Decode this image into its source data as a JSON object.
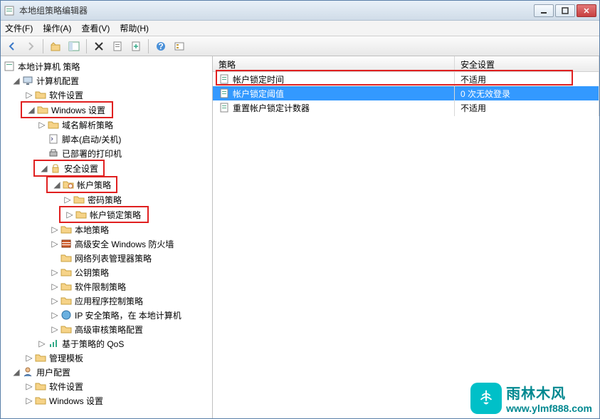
{
  "window": {
    "title": "本地组策略编辑器"
  },
  "menu": {
    "file": "文件(F)",
    "action": "操作(A)",
    "view": "查看(V)",
    "help": "帮助(H)"
  },
  "tree": {
    "root": "本地计算机 策略",
    "computer_config": "计算机配置",
    "software_settings": "软件设置",
    "windows_settings": "Windows 设置",
    "name_resolution": "域名解析策略",
    "scripts": "脚本(启动/关机)",
    "printers": "已部署的打印机",
    "security_settings": "安全设置",
    "account_policies": "帐户策略",
    "password_policy": "密码策略",
    "lockout_policy": "帐户锁定策略",
    "local_policies": "本地策略",
    "firewall": "高级安全 Windows 防火墙",
    "network_list": "网络列表管理器策略",
    "public_key": "公钥策略",
    "software_restriction": "软件限制策略",
    "app_control": "应用程序控制策略",
    "ipsec": "IP 安全策略，在 本地计算机",
    "audit": "高级审核策略配置",
    "qos": "基于策略的 QoS",
    "admin_templates": "管理模板",
    "user_config": "用户配置",
    "user_software": "软件设置",
    "user_windows": "Windows 设置"
  },
  "list": {
    "col_policy": "策略",
    "col_setting": "安全设置",
    "rows": [
      {
        "name": "帐户锁定时间",
        "value": "不适用"
      },
      {
        "name": "帐户锁定阈值",
        "value": "0 次无效登录"
      },
      {
        "name": "重置帐户锁定计数器",
        "value": "不适用"
      }
    ]
  },
  "watermark": {
    "cn": "雨林木风",
    "url": "www.ylmf888.com"
  }
}
